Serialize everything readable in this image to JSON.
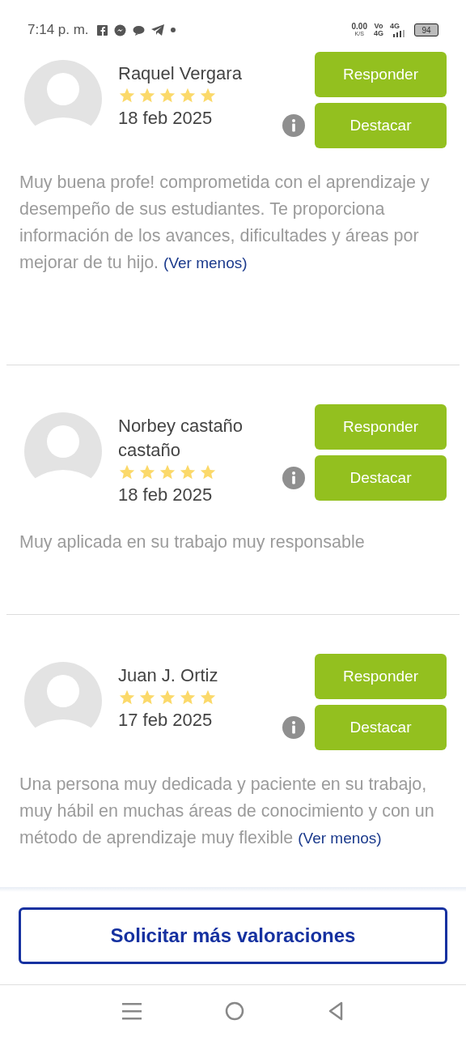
{
  "status_bar": {
    "time": "7:14 p. m.",
    "speed": "0.00",
    "speed_unit": "K/S",
    "volte_top": "Vo",
    "volte_bottom": "4G",
    "network": "4G",
    "battery": "94"
  },
  "reviews": [
    {
      "name": "Raquel Vergara",
      "stars": 5,
      "date": "18 feb 2025",
      "reply_label": "Responder",
      "highlight_label": "Destacar",
      "comment": "Muy buena profe! comprometida con el aprendizaje y desempeño de sus estudiantes. Te proporciona información de los avances, dificultades y áreas por mejorar de tu hijo.",
      "toggle_link": "(Ver menos)"
    },
    {
      "name": "Norbey castaño castaño",
      "stars": 5,
      "date": "18 feb 2025",
      "reply_label": "Responder",
      "highlight_label": "Destacar",
      "comment": "Muy aplicada en su trabajo muy responsable"
    },
    {
      "name": "Juan J. Ortiz",
      "stars": 5,
      "date": "17 feb 2025",
      "reply_label": "Responder",
      "highlight_label": "Destacar",
      "comment": "Una persona muy dedicada y paciente en su trabajo, muy hábil en muchas áreas de conocimiento y con un método de aprendizaje muy flexible",
      "toggle_link": "(Ver menos)"
    }
  ],
  "request_button": "Solicitar más valoraciones"
}
